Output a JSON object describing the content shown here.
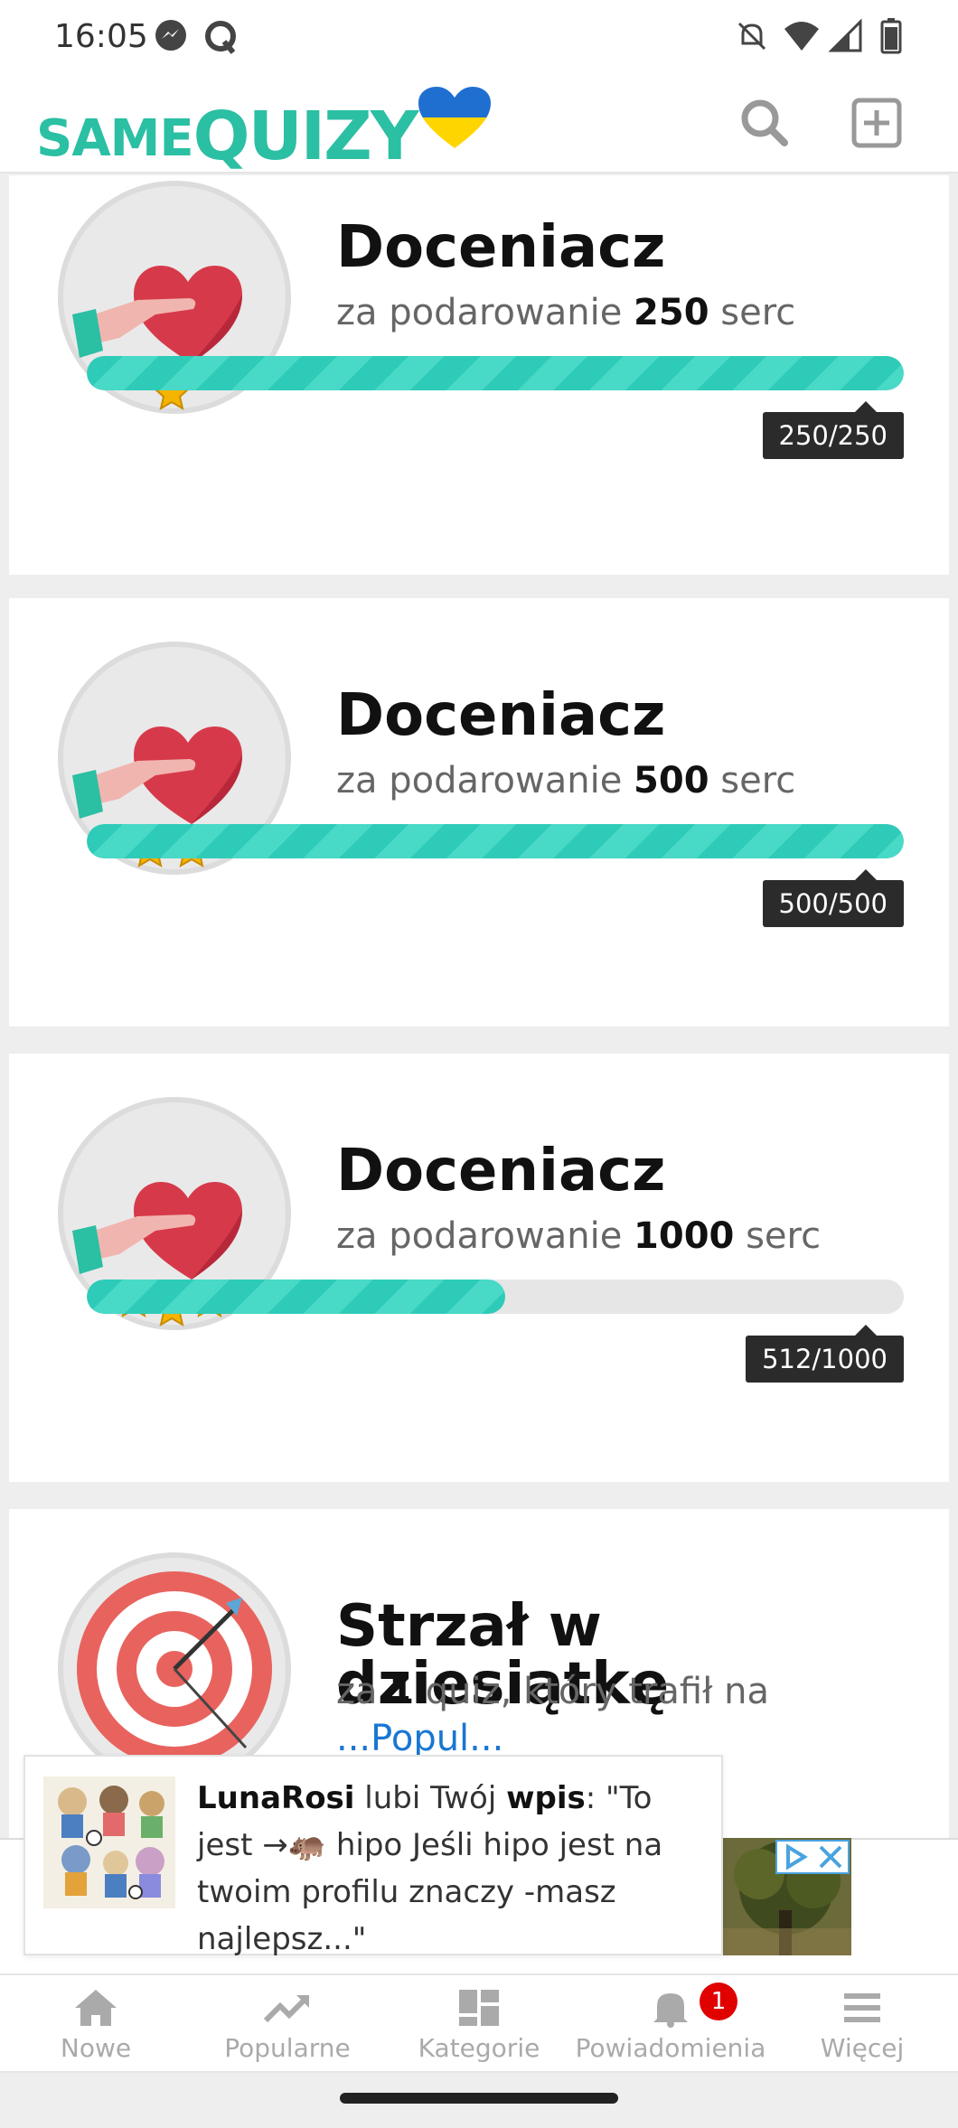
{
  "status_bar": {
    "time": "16:05"
  },
  "header": {
    "logo_same": "SAME",
    "logo_quizy": "QUIZY"
  },
  "achievements": [
    {
      "title": "Doceniacz",
      "desc_prefix": "za podarowanie ",
      "desc_bold": "250",
      "desc_suffix": " serc",
      "stars": 1,
      "progress": 1.0,
      "progress_label": "250/250"
    },
    {
      "title": "Doceniacz",
      "desc_prefix": "za podarowanie ",
      "desc_bold": "500",
      "desc_suffix": " serc",
      "stars": 2,
      "progress": 1.0,
      "progress_label": "500/500"
    },
    {
      "title": "Doceniacz",
      "desc_prefix": "za podarowanie ",
      "desc_bold": "1000",
      "desc_suffix": " serc",
      "stars": 3,
      "progress": 0.512,
      "progress_label": "512/1000"
    },
    {
      "title": "Strzał w dziesiątkę",
      "desc_prefix": "za ",
      "desc_bold": "1",
      "desc_suffix": " quiz, który trafił na",
      "desc_line2": "...Popul..."
    }
  ],
  "notification": {
    "user": "LunaRosi",
    "mid": " lubi Twój ",
    "object": "wpis",
    "quote": ": \"To jest →🦛 hipo Jeśli hipo jest na twoim profilu znaczy -masz najlepsz...\""
  },
  "bottom_nav": {
    "items": [
      {
        "label": "Nowe",
        "icon": "home-icon"
      },
      {
        "label": "Popularne",
        "icon": "trending-icon"
      },
      {
        "label": "Kategorie",
        "icon": "categories-icon"
      },
      {
        "label": "Powiadomienia",
        "icon": "bell-icon",
        "badge": "1"
      },
      {
        "label": "Więcej",
        "icon": "menu-icon"
      }
    ]
  },
  "colors": {
    "accent": "#2bbfa4",
    "progress": "#2ecbb8",
    "badge": "#e10000"
  }
}
